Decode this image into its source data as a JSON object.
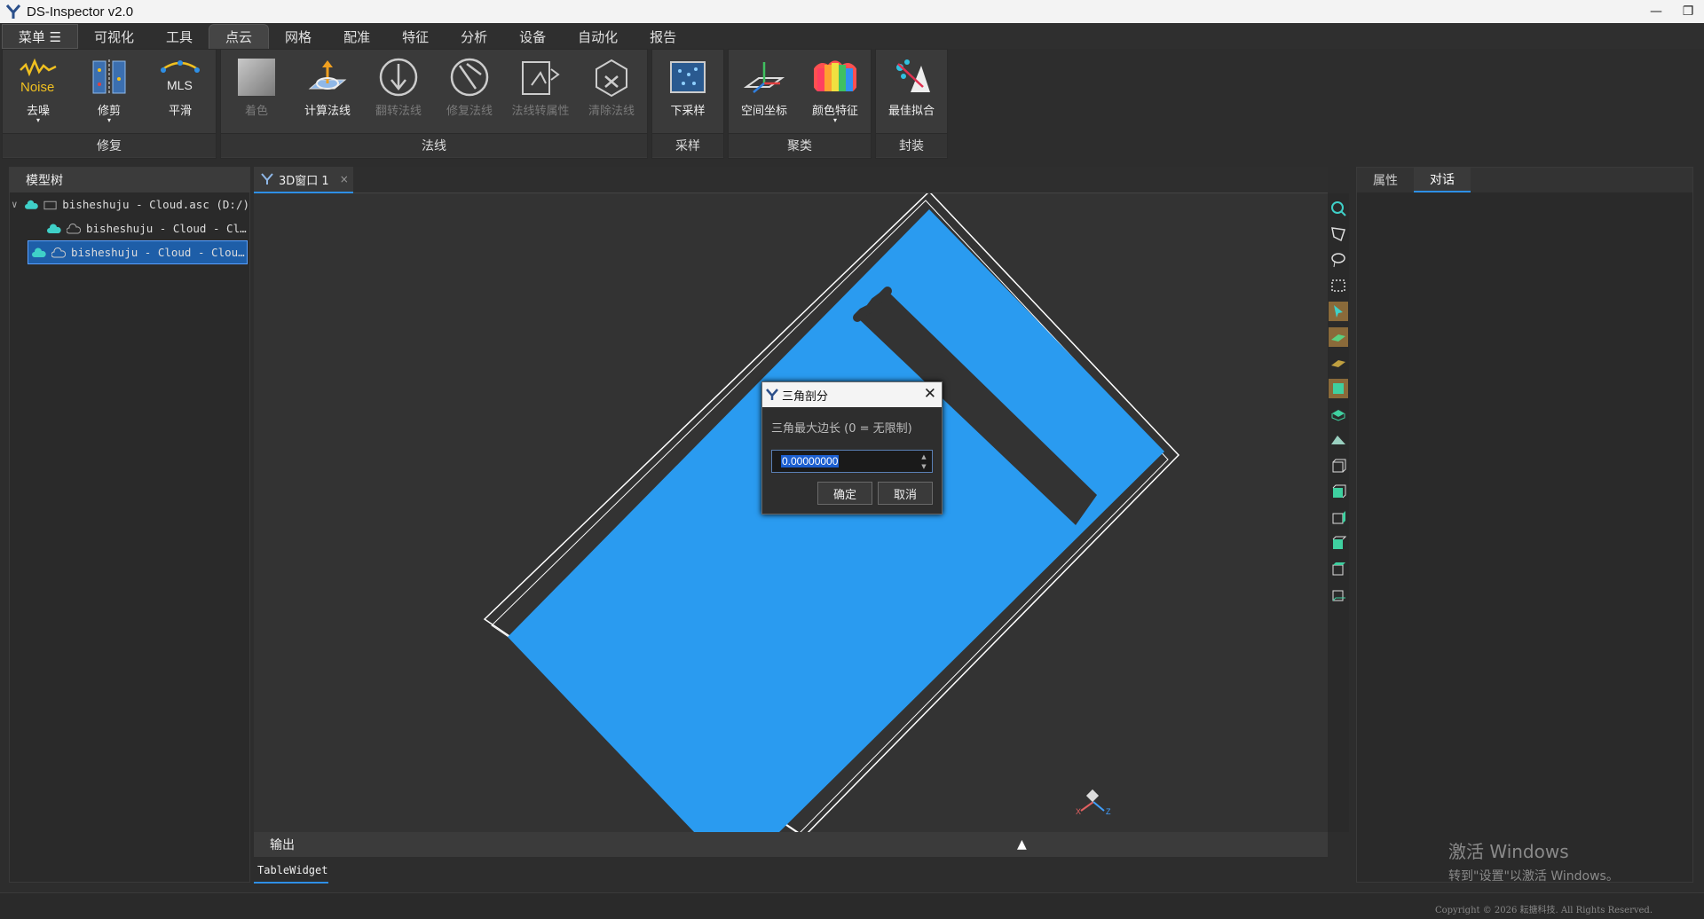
{
  "app": {
    "title": "DS-Inspector v2.0"
  },
  "window_controls": {
    "minimize": "—",
    "restore": "❐"
  },
  "menubar": {
    "toggle_label": "菜单 ☰",
    "items": [
      "可视化",
      "工具",
      "点云",
      "网格",
      "配准",
      "特征",
      "分析",
      "设备",
      "自动化",
      "报告"
    ],
    "active": "点云"
  },
  "ribbon": {
    "groups": [
      {
        "label": "修复",
        "buttons": [
          {
            "label": "去噪",
            "icon": "noise-icon",
            "icon_text": "Noise",
            "dropdown": true,
            "enabled": true
          },
          {
            "label": "修剪",
            "icon": "trim-icon",
            "dropdown": true,
            "enabled": true
          },
          {
            "label": "平滑",
            "icon": "mls-smooth-icon",
            "icon_text": "MLS",
            "enabled": true
          }
        ]
      },
      {
        "label": "法线",
        "buttons": [
          {
            "label": "着色",
            "icon": "color-swatch-icon",
            "enabled": false
          },
          {
            "label": "计算法线",
            "icon": "compute-normals-icon",
            "enabled": true
          },
          {
            "label": "翻转法线",
            "icon": "flip-normals-icon",
            "enabled": false
          },
          {
            "label": "修复法线",
            "icon": "repair-normals-icon",
            "enabled": false
          },
          {
            "label": "法线转属性",
            "icon": "normals-to-attribute-icon",
            "enabled": false
          },
          {
            "label": "清除法线",
            "icon": "clear-normals-icon",
            "enabled": false
          }
        ]
      },
      {
        "label": "采样",
        "buttons": [
          {
            "label": "下采样",
            "icon": "downsample-icon",
            "enabled": true
          }
        ]
      },
      {
        "label": "聚类",
        "buttons": [
          {
            "label": "空间坐标",
            "icon": "spatial-coordinates-icon",
            "enabled": true
          },
          {
            "label": "颜色特征",
            "icon": "color-feature-icon",
            "dropdown": true,
            "enabled": true
          }
        ]
      },
      {
        "label": "封装",
        "buttons": [
          {
            "label": "最佳拟合",
            "icon": "best-fit-icon",
            "enabled": true
          }
        ]
      }
    ]
  },
  "left_panel": {
    "title": "模型树",
    "tree": [
      {
        "text": "bisheshuju - Cloud.asc (D:/)",
        "level": 0,
        "expanded": true,
        "selected": false
      },
      {
        "text": "bisheshuju - Cloud - Cl…",
        "level": 1,
        "selected": false
      },
      {
        "text": "bisheshuju - Cloud - Clou…",
        "level": 0,
        "selected": true
      }
    ]
  },
  "view": {
    "tab_label": "3D窗口 1",
    "tab_close": "×"
  },
  "axis_labels": {
    "x": "X",
    "z": "Z"
  },
  "toolstrip": [
    "zoom-fit-icon",
    "polygon-select-icon",
    "lasso-select-icon",
    "rect-select-icon",
    "pointer-icon",
    "layer-1-icon",
    "layer-2-icon",
    "layer-3-icon",
    "layer-4-icon",
    "plane-icon",
    "view-front-icon",
    "view-back-icon",
    "view-left-icon",
    "view-right-icon",
    "view-top-icon",
    "view-bottom-icon"
  ],
  "output": {
    "title": "输出",
    "toggle": "▲",
    "tab": "TableWidget"
  },
  "right_panel": {
    "tabs": [
      "属性",
      "对话"
    ],
    "active": "对话"
  },
  "dialog": {
    "title": "三角剖分",
    "close": "✕",
    "label": "三角最大边长 (0 = 无限制)",
    "value": "0.00000000",
    "ok": "确定",
    "cancel": "取消"
  },
  "watermark": {
    "line1": "激活 Windows",
    "line2": "转到\"设置\"以激活 Windows。"
  },
  "status": {
    "copyright": "Copyright © 2026 耘搪科技. All Rights Reserved."
  },
  "colors": {
    "cloud_fill": "#2a9bf0",
    "accent": "#2e8fe6",
    "selection": "#1e5ea8"
  }
}
